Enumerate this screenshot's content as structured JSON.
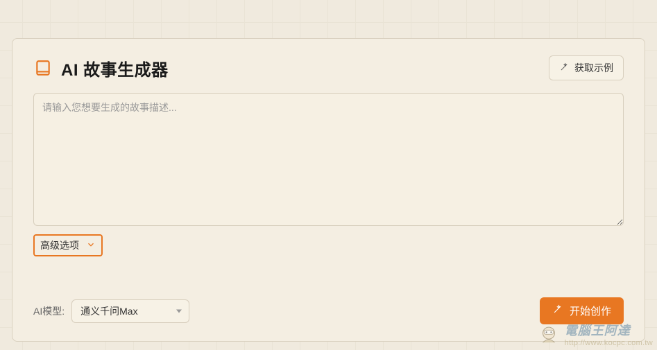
{
  "header": {
    "title": "AI 故事生成器",
    "example_button": "获取示例"
  },
  "prompt": {
    "placeholder": "请输入您想要生成的故事描述...",
    "value": ""
  },
  "advanced": {
    "toggle_label": "高级选项"
  },
  "model": {
    "label": "AI模型:",
    "selected": "通义千问Max"
  },
  "actions": {
    "start_label": "开始创作"
  },
  "watermark": {
    "title": "電腦王阿達",
    "url": "http://www.kocpc.com.tw"
  }
}
